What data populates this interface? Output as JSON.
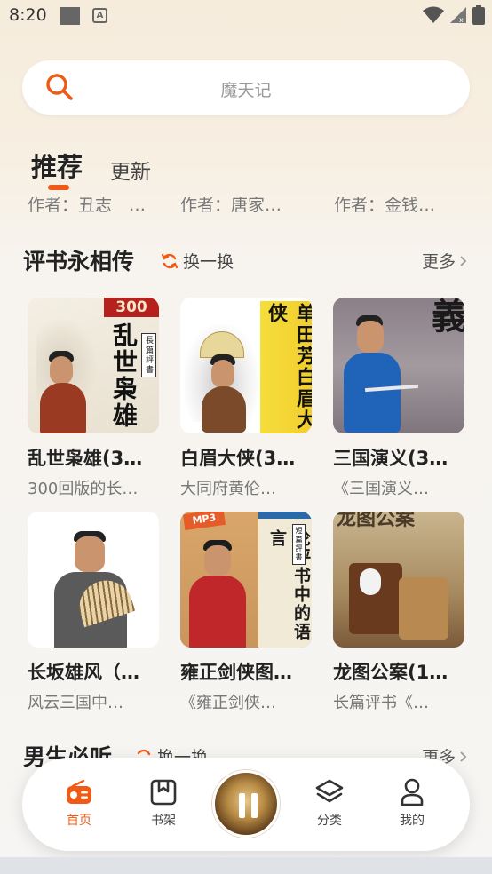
{
  "status_bar": {
    "time": "8:20"
  },
  "search": {
    "placeholder": "魔天记"
  },
  "tabs": [
    {
      "label": "推荐",
      "active": true
    },
    {
      "label": "更新",
      "active": false
    }
  ],
  "partial_authors": [
    "作者：丑志　…",
    "作者：唐家…",
    "作者：金钱…"
  ],
  "section_pingshu": {
    "title": "评书永相传",
    "refresh_label": "换一换",
    "more_label": "更多",
    "books": [
      {
        "title": "乱世枭雄(3…",
        "desc": "300回版的长…",
        "cover_text": "乱世枭雄",
        "badge": "300",
        "tag": "長篇評書"
      },
      {
        "title": "白眉大侠(3…",
        "desc": "大同府黄伦…",
        "cover_text": "单田芳白眉大侠"
      },
      {
        "title": "三国演义(3…",
        "desc": "《三国演义…",
        "cover_text": "三國演義"
      },
      {
        "title": "长坂雄风（…",
        "desc": "风云三国中…",
        "cover_text": ""
      },
      {
        "title": "雍正剑侠图…",
        "desc": "《雍正剑侠…",
        "cover_text": "论评书中的语言",
        "badge": "MP3",
        "tag": "短篇評書"
      },
      {
        "title": "龙图公案(1…",
        "desc": "长篇评书《…",
        "cover_text": "龙图公案"
      }
    ]
  },
  "section_boys": {
    "title": "男生必听",
    "refresh_label": "换一换",
    "more_label": "更多"
  },
  "bottom_nav": [
    {
      "label": "首页",
      "icon": "radio-icon",
      "active": true
    },
    {
      "label": "书架",
      "icon": "bookshelf-icon",
      "active": false
    },
    {
      "label": "分类",
      "icon": "layers-icon",
      "active": false
    },
    {
      "label": "我的",
      "icon": "person-icon",
      "active": false
    }
  ],
  "colors": {
    "accent": "#ef5a16",
    "background": "#f6f5f3",
    "card": "#ffffff"
  }
}
